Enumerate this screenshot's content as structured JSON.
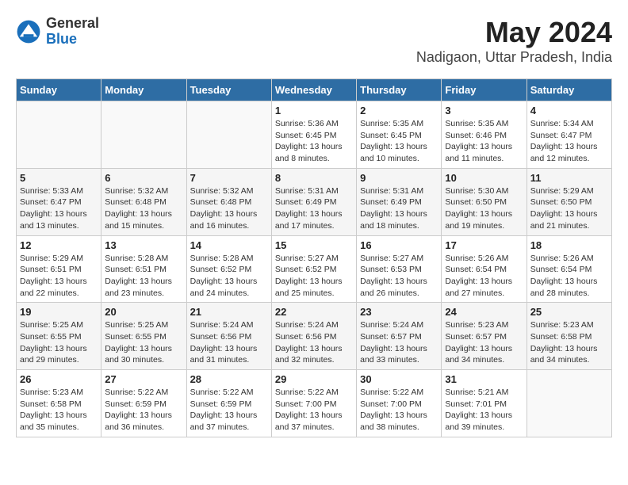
{
  "header": {
    "logo": {
      "general": "General",
      "blue": "Blue"
    },
    "title": "May 2024",
    "subtitle": "Nadigaon, Uttar Pradesh, India"
  },
  "weekdays": [
    "Sunday",
    "Monday",
    "Tuesday",
    "Wednesday",
    "Thursday",
    "Friday",
    "Saturday"
  ],
  "weeks": [
    [
      {
        "day": "",
        "info": ""
      },
      {
        "day": "",
        "info": ""
      },
      {
        "day": "",
        "info": ""
      },
      {
        "day": "1",
        "info": "Sunrise: 5:36 AM\nSunset: 6:45 PM\nDaylight: 13 hours\nand 8 minutes."
      },
      {
        "day": "2",
        "info": "Sunrise: 5:35 AM\nSunset: 6:45 PM\nDaylight: 13 hours\nand 10 minutes."
      },
      {
        "day": "3",
        "info": "Sunrise: 5:35 AM\nSunset: 6:46 PM\nDaylight: 13 hours\nand 11 minutes."
      },
      {
        "day": "4",
        "info": "Sunrise: 5:34 AM\nSunset: 6:47 PM\nDaylight: 13 hours\nand 12 minutes."
      }
    ],
    [
      {
        "day": "5",
        "info": "Sunrise: 5:33 AM\nSunset: 6:47 PM\nDaylight: 13 hours\nand 13 minutes."
      },
      {
        "day": "6",
        "info": "Sunrise: 5:32 AM\nSunset: 6:48 PM\nDaylight: 13 hours\nand 15 minutes."
      },
      {
        "day": "7",
        "info": "Sunrise: 5:32 AM\nSunset: 6:48 PM\nDaylight: 13 hours\nand 16 minutes."
      },
      {
        "day": "8",
        "info": "Sunrise: 5:31 AM\nSunset: 6:49 PM\nDaylight: 13 hours\nand 17 minutes."
      },
      {
        "day": "9",
        "info": "Sunrise: 5:31 AM\nSunset: 6:49 PM\nDaylight: 13 hours\nand 18 minutes."
      },
      {
        "day": "10",
        "info": "Sunrise: 5:30 AM\nSunset: 6:50 PM\nDaylight: 13 hours\nand 19 minutes."
      },
      {
        "day": "11",
        "info": "Sunrise: 5:29 AM\nSunset: 6:50 PM\nDaylight: 13 hours\nand 21 minutes."
      }
    ],
    [
      {
        "day": "12",
        "info": "Sunrise: 5:29 AM\nSunset: 6:51 PM\nDaylight: 13 hours\nand 22 minutes."
      },
      {
        "day": "13",
        "info": "Sunrise: 5:28 AM\nSunset: 6:51 PM\nDaylight: 13 hours\nand 23 minutes."
      },
      {
        "day": "14",
        "info": "Sunrise: 5:28 AM\nSunset: 6:52 PM\nDaylight: 13 hours\nand 24 minutes."
      },
      {
        "day": "15",
        "info": "Sunrise: 5:27 AM\nSunset: 6:52 PM\nDaylight: 13 hours\nand 25 minutes."
      },
      {
        "day": "16",
        "info": "Sunrise: 5:27 AM\nSunset: 6:53 PM\nDaylight: 13 hours\nand 26 minutes."
      },
      {
        "day": "17",
        "info": "Sunrise: 5:26 AM\nSunset: 6:54 PM\nDaylight: 13 hours\nand 27 minutes."
      },
      {
        "day": "18",
        "info": "Sunrise: 5:26 AM\nSunset: 6:54 PM\nDaylight: 13 hours\nand 28 minutes."
      }
    ],
    [
      {
        "day": "19",
        "info": "Sunrise: 5:25 AM\nSunset: 6:55 PM\nDaylight: 13 hours\nand 29 minutes."
      },
      {
        "day": "20",
        "info": "Sunrise: 5:25 AM\nSunset: 6:55 PM\nDaylight: 13 hours\nand 30 minutes."
      },
      {
        "day": "21",
        "info": "Sunrise: 5:24 AM\nSunset: 6:56 PM\nDaylight: 13 hours\nand 31 minutes."
      },
      {
        "day": "22",
        "info": "Sunrise: 5:24 AM\nSunset: 6:56 PM\nDaylight: 13 hours\nand 32 minutes."
      },
      {
        "day": "23",
        "info": "Sunrise: 5:24 AM\nSunset: 6:57 PM\nDaylight: 13 hours\nand 33 minutes."
      },
      {
        "day": "24",
        "info": "Sunrise: 5:23 AM\nSunset: 6:57 PM\nDaylight: 13 hours\nand 34 minutes."
      },
      {
        "day": "25",
        "info": "Sunrise: 5:23 AM\nSunset: 6:58 PM\nDaylight: 13 hours\nand 34 minutes."
      }
    ],
    [
      {
        "day": "26",
        "info": "Sunrise: 5:23 AM\nSunset: 6:58 PM\nDaylight: 13 hours\nand 35 minutes."
      },
      {
        "day": "27",
        "info": "Sunrise: 5:22 AM\nSunset: 6:59 PM\nDaylight: 13 hours\nand 36 minutes."
      },
      {
        "day": "28",
        "info": "Sunrise: 5:22 AM\nSunset: 6:59 PM\nDaylight: 13 hours\nand 37 minutes."
      },
      {
        "day": "29",
        "info": "Sunrise: 5:22 AM\nSunset: 7:00 PM\nDaylight: 13 hours\nand 37 minutes."
      },
      {
        "day": "30",
        "info": "Sunrise: 5:22 AM\nSunset: 7:00 PM\nDaylight: 13 hours\nand 38 minutes."
      },
      {
        "day": "31",
        "info": "Sunrise: 5:21 AM\nSunset: 7:01 PM\nDaylight: 13 hours\nand 39 minutes."
      },
      {
        "day": "",
        "info": ""
      }
    ]
  ]
}
